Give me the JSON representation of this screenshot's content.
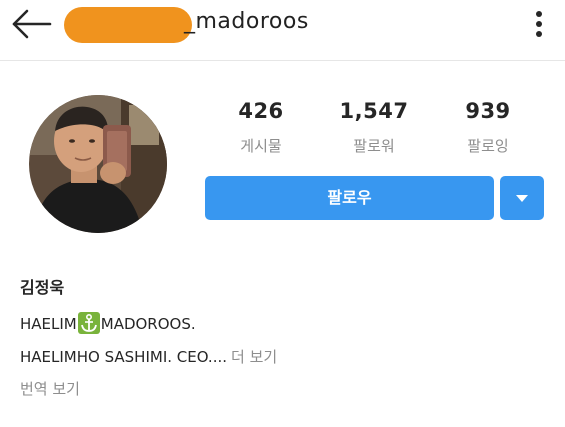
{
  "header": {
    "username": "_madoroos",
    "redaction_color": "#f0931e",
    "back_icon": "arrow-left-icon",
    "more_icon": "more-vertical-icon"
  },
  "profile": {
    "avatar_icon": "profile-photo",
    "stats": [
      {
        "count": "426",
        "label": "게시물"
      },
      {
        "count": "1,547",
        "label": "팔로워"
      },
      {
        "count": "939",
        "label": "팔로잉"
      }
    ],
    "follow_label": "팔로우",
    "accent_color": "#3897f0",
    "dropdown_icon": "caret-down-icon"
  },
  "bio": {
    "name": "김정욱",
    "line1_before": "HAELIM",
    "line1_emoji": "anchor-emoji",
    "line1_after": "MADOROOS.",
    "line2": "HAELIMHO SASHIMI. CEO....",
    "more_label": "더 보기",
    "translate_label": "번역 보기"
  }
}
